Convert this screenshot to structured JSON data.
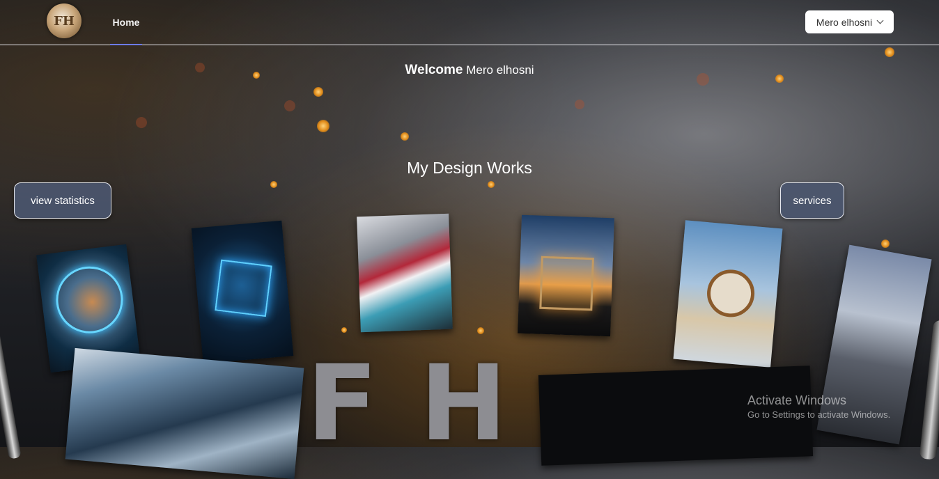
{
  "header": {
    "logo_text": "FH",
    "nav": [
      {
        "label": "Home",
        "active": true
      }
    ],
    "user_menu": {
      "label": "Mero elhosni",
      "icon": "chevron-down-icon"
    },
    "accent_color": "#6c7bff"
  },
  "welcome": {
    "bold": "Welcome",
    "name": "Mero elhosni"
  },
  "section": {
    "title": "My Design Works"
  },
  "buttons": {
    "view_statistics": "view statistics",
    "services": "services"
  },
  "gallery": {
    "cards": [
      {
        "name": "astronaut-artwork"
      },
      {
        "name": "glass-cube-grid-artwork"
      },
      {
        "name": "abstract-stripes-artwork"
      },
      {
        "name": "glass-cube-sunset-artwork"
      },
      {
        "name": "steampunk-clock-artwork"
      },
      {
        "name": "futuristic-bridge-artwork"
      },
      {
        "name": "metallic-architecture-artwork"
      },
      {
        "name": "dark-panel-artwork"
      }
    ],
    "letters": "FH"
  },
  "watermark": {
    "title": "Activate Windows",
    "subtitle": "Go to Settings to activate Windows."
  }
}
